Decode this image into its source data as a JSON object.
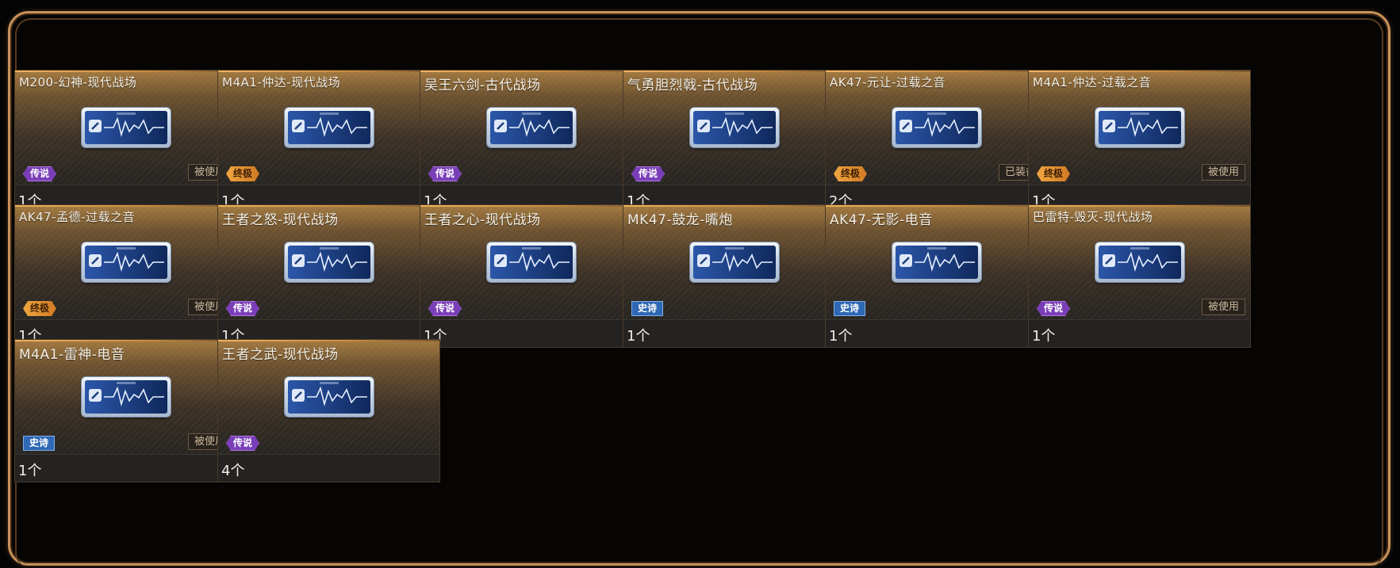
{
  "colors": {
    "frame_border": "#c9925a",
    "rarity_legend": "#7a3fb8",
    "rarity_ultimate": "#f0a640",
    "rarity_epic": "#2f68b4"
  },
  "ticket_icon": "sound-ticket-icon",
  "items": [
    {
      "name": "M200-幻神-现代战场",
      "rarity": "传说",
      "rarity_type": "legend",
      "status": "被使用",
      "count": "1个"
    },
    {
      "name": "M4A1-仲达-现代战场",
      "rarity": "终极",
      "rarity_type": "ultimate",
      "status": "",
      "count": "1个"
    },
    {
      "name": "吴王六剑-古代战场",
      "rarity": "传说",
      "rarity_type": "legend",
      "status": "",
      "count": "1个"
    },
    {
      "name": "气勇胆烈戟-古代战场",
      "rarity": "传说",
      "rarity_type": "legend",
      "status": "",
      "count": "1个"
    },
    {
      "name": "AK47-元让-过载之音",
      "rarity": "终极",
      "rarity_type": "ultimate",
      "status": "已装备",
      "count": "2个"
    },
    {
      "name": "M4A1-仲达-过载之音",
      "rarity": "终极",
      "rarity_type": "ultimate",
      "status": "被使用",
      "count": "1个"
    },
    {
      "name": "AK47-孟德-过载之音",
      "rarity": "终极",
      "rarity_type": "ultimate",
      "status": "被使用",
      "count": "1个"
    },
    {
      "name": "王者之怒-现代战场",
      "rarity": "传说",
      "rarity_type": "legend",
      "status": "",
      "count": "1个"
    },
    {
      "name": "王者之心-现代战场",
      "rarity": "传说",
      "rarity_type": "legend",
      "status": "",
      "count": "1个"
    },
    {
      "name": "MK47-鼓龙-嘴炮",
      "rarity": "史诗",
      "rarity_type": "epic",
      "status": "",
      "count": "1个"
    },
    {
      "name": "AK47-无影-电音",
      "rarity": "史诗",
      "rarity_type": "epic",
      "status": "",
      "count": "1个"
    },
    {
      "name": "巴雷特-毁灭-现代战场",
      "rarity": "传说",
      "rarity_type": "legend",
      "status": "被使用",
      "count": "1个"
    },
    {
      "name": "M4A1-雷神-电音",
      "rarity": "史诗",
      "rarity_type": "epic",
      "status": "被使用",
      "count": "1个"
    },
    {
      "name": "王者之武-现代战场",
      "rarity": "传说",
      "rarity_type": "legend",
      "status": "",
      "count": "4个"
    }
  ]
}
